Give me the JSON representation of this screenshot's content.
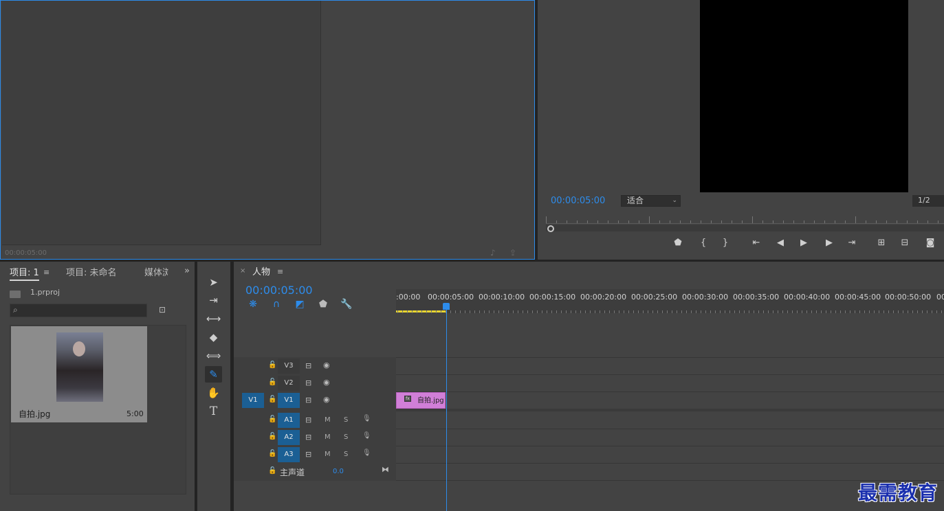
{
  "source_monitor": {
    "timecode": "00:00:05:00",
    "icons": [
      "audio-export-icon",
      "export-icon"
    ]
  },
  "program_monitor": {
    "timecode": "00:00:05:00",
    "fit": "适合",
    "resolution": "1/2",
    "controls": [
      "add-marker-icon",
      "mark-in-icon",
      "mark-out-icon",
      "go-to-in-icon",
      "step-back-icon",
      "play-icon",
      "step-forward-icon",
      "go-to-out-icon",
      "lift-icon",
      "extract-icon",
      "export-frame-icon"
    ]
  },
  "project_panel": {
    "tabs": [
      "项目: 1",
      "项目: 未命名",
      "媒体浏"
    ],
    "project_file": "1.prproj",
    "search_placeholder": "",
    "clip": {
      "name": "自拍.jpg",
      "duration": "5:00"
    }
  },
  "tools": [
    "selection-tool-icon",
    "track-select-tool-icon",
    "ripple-edit-tool-icon",
    "razor-tool-icon",
    "slip-tool-icon",
    "pen-tool-icon",
    "hand-tool-icon",
    "type-tool-icon"
  ],
  "timeline": {
    "sequence_name": "人物",
    "timecode": "00:00:05:00",
    "ruler_labels": [
      ":00:00",
      "00:00:05:00",
      "00:00:10:00",
      "00:00:15:00",
      "00:00:20:00",
      "00:00:25:00",
      "00:00:30:00",
      "00:00:35:00",
      "00:00:40:00",
      "00:00:45:00",
      "00:00:50:00",
      "00"
    ],
    "video_tracks": [
      {
        "id": "V3",
        "source": ""
      },
      {
        "id": "V2",
        "source": ""
      },
      {
        "id": "V1",
        "source": "V1"
      }
    ],
    "audio_tracks": [
      {
        "id": "A1",
        "m": "M",
        "s": "S"
      },
      {
        "id": "A2",
        "m": "M",
        "s": "S"
      },
      {
        "id": "A3",
        "m": "M",
        "s": "S"
      }
    ],
    "master": {
      "label": "主声道",
      "value": "0.0"
    },
    "clip": {
      "name": "自拍.jpg",
      "badge": "fx"
    }
  },
  "watermark": "最需教育"
}
